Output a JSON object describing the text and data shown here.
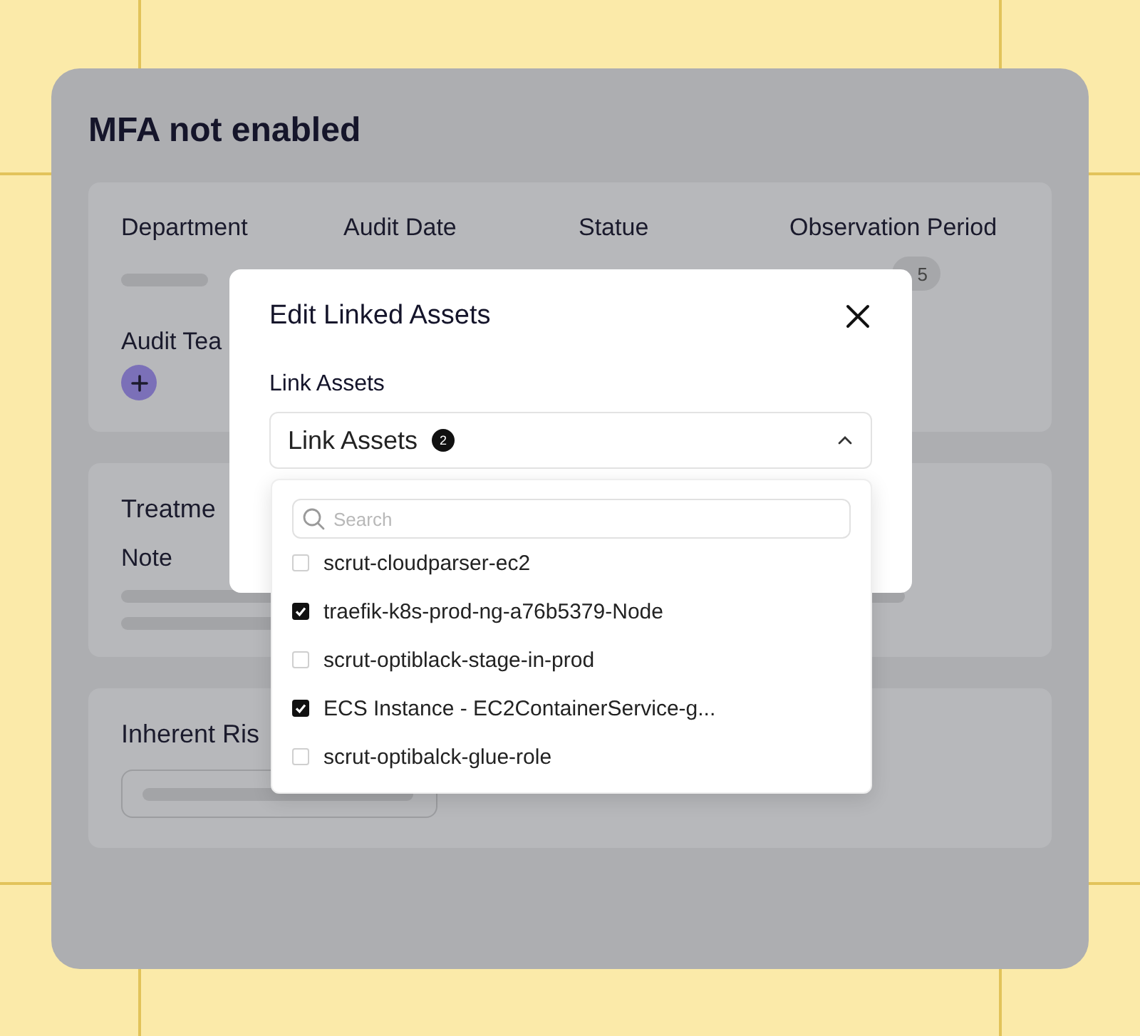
{
  "page": {
    "title": "MFA not enabled"
  },
  "details": {
    "fields": [
      {
        "label": "Department",
        "kind": "bar"
      },
      {
        "label": "Audit Date",
        "kind": "empty"
      },
      {
        "label": "Statue",
        "kind": "empty"
      },
      {
        "label": "Observation Period",
        "kind": "pill",
        "value": "5"
      }
    ],
    "team_label": "Audit Tea"
  },
  "treatment": {
    "title": "Treatme",
    "note_label": "Note"
  },
  "risk": {
    "title": "Inherent Ris"
  },
  "modal": {
    "title": "Edit Linked Assets",
    "field_label": "Link Assets",
    "select": {
      "value": "Link Assets",
      "count": "2",
      "expanded": true
    },
    "search": {
      "placeholder": "Search"
    },
    "options": [
      {
        "label": "scrut-cloudparser-ec2",
        "checked": false
      },
      {
        "label": "traefik-k8s-prod-ng-a76b5379-Node",
        "checked": true
      },
      {
        "label": "scrut-optiblack-stage-in-prod",
        "checked": false
      },
      {
        "label": "ECS Instance - EC2ContainerService-g...",
        "checked": true
      },
      {
        "label": "scrut-optibalck-glue-role",
        "checked": false
      }
    ]
  }
}
